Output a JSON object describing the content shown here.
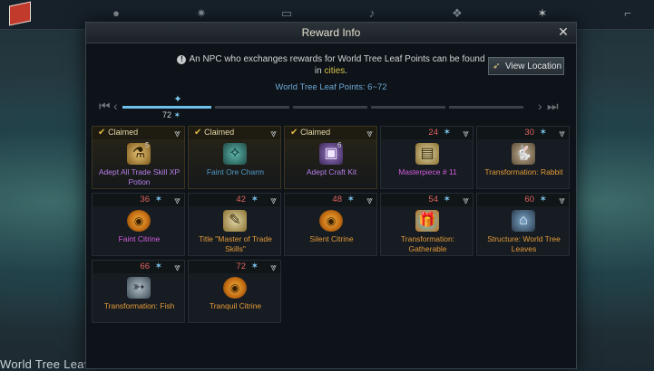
{
  "background": {
    "bottom_label": "World Tree Leav"
  },
  "top_bar": {
    "icons": [
      "flag-icon",
      "cookie-icon",
      "star-burst-icon",
      "screen-icon",
      "brush-icon",
      "tree-icon",
      "leaf-icon",
      "telescope-icon"
    ]
  },
  "modal": {
    "title": "Reward Info",
    "close_label": "✕",
    "notice_part1": "An NPC who exchanges rewards for World Tree Leaf Points can be found in ",
    "notice_highlight": "cities",
    "notice_part2": ".",
    "view_location_label": "View Location",
    "points_label": "World Tree Leaf Points: 6~72",
    "progress": {
      "current_value": "72",
      "filled_fraction": 0.24
    },
    "claimed_label": "Claimed",
    "rewards": [
      {
        "points": "",
        "claimed": true,
        "name": "Adept All Trade Skill XP Potion",
        "count": "5",
        "icon": "potion-icon",
        "color": "purple"
      },
      {
        "points": "",
        "claimed": true,
        "name": "Faint Ore Charm",
        "count": "",
        "icon": "ore-charm-icon",
        "color": "blue"
      },
      {
        "points": "",
        "claimed": true,
        "name": "Adept Craft Kit",
        "count": "6",
        "icon": "craft-kit-icon",
        "color": "purple"
      },
      {
        "points": "24",
        "claimed": false,
        "name": "Masterpiece # 11",
        "count": "",
        "icon": "masterpiece-icon",
        "color": "magenta"
      },
      {
        "points": "30",
        "claimed": false,
        "name": "Transformation: Rabbit",
        "count": "",
        "icon": "rabbit-icon",
        "color": "orange"
      },
      {
        "points": "36",
        "claimed": false,
        "name": "Faint Citrine",
        "count": "",
        "icon": "citrine-icon",
        "color": "magenta"
      },
      {
        "points": "42",
        "claimed": false,
        "name": "Title \"Master of Trade Skills\"",
        "count": "",
        "icon": "scroll-icon",
        "color": "orange"
      },
      {
        "points": "48",
        "claimed": false,
        "name": "Silent Citrine",
        "count": "",
        "icon": "citrine-icon",
        "color": "orange"
      },
      {
        "points": "54",
        "claimed": false,
        "name": "Transformation: Gatherable",
        "count": "",
        "icon": "gift-icon",
        "color": "orange"
      },
      {
        "points": "60",
        "claimed": false,
        "name": "Structure: World Tree Leaves",
        "count": "",
        "icon": "tree-structure-icon",
        "color": "orange"
      },
      {
        "points": "66",
        "claimed": false,
        "name": "Transformation: Fish",
        "count": "",
        "icon": "fish-icon",
        "color": "orange"
      },
      {
        "points": "72",
        "claimed": false,
        "name": "Tranquil Citrine",
        "count": "",
        "icon": "citrine-icon",
        "color": "orange"
      }
    ]
  }
}
